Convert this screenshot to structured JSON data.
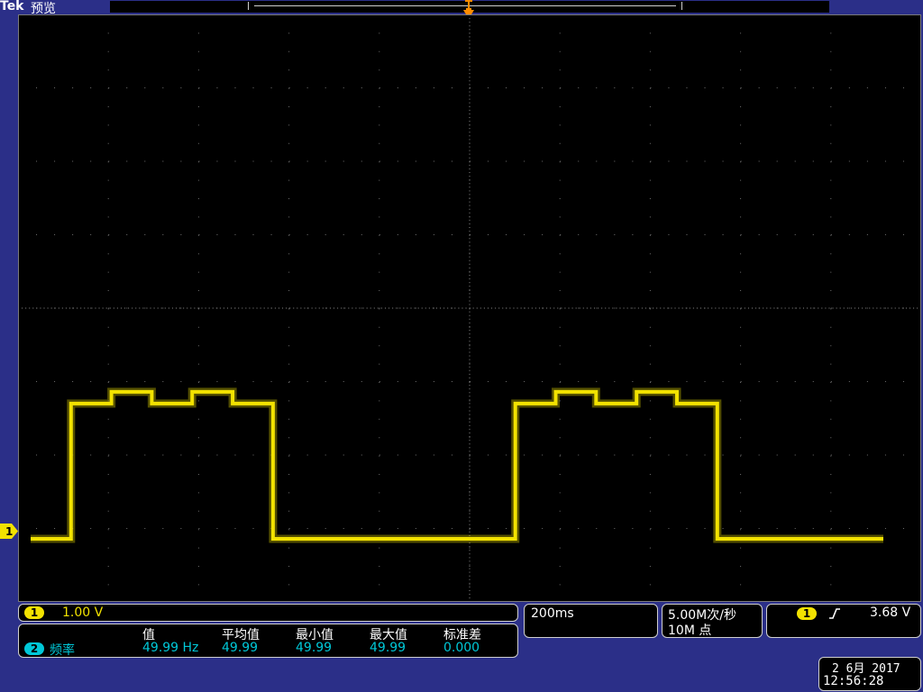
{
  "header": {
    "brand": "Tek",
    "mode": "预览"
  },
  "channel1": {
    "marker": "1",
    "scale": "1.00 V",
    "color": "#f2e200"
  },
  "measurement": {
    "badge": "2",
    "label": "频率",
    "columns": [
      "值",
      "平均值",
      "最小值",
      "最大值",
      "标准差"
    ],
    "values": [
      "49.99 Hz",
      "49.99",
      "49.99",
      "49.99",
      "0.000"
    ],
    "color": "#00c8d8"
  },
  "timebase": {
    "value": "200ms"
  },
  "acquisition": {
    "sample_rate": "5.00M次/秒",
    "record_length": "10M 点"
  },
  "trigger": {
    "source": "1",
    "slope_icon": "rising-edge-icon",
    "level": "3.68 V"
  },
  "datetime": {
    "date": "2 6月 2017",
    "time": "12:56:28"
  },
  "chart_data": {
    "type": "line",
    "series": [
      {
        "x": [
          0,
          0.18,
          0.18,
          0.36,
          0.36,
          0.54,
          0.54,
          0.72,
          0.72,
          0.9,
          0.9,
          1.08,
          1.08,
          1.26,
          1.26,
          1.44,
          1.44,
          1.62,
          1.62,
          1.8,
          1.8,
          1.98,
          1.98,
          2.16,
          2.16,
          2.34,
          2.34,
          2.52,
          2.52,
          2.7,
          2.7,
          2.88,
          2.88,
          3.06,
          3.06,
          3.24,
          3.24,
          3.42,
          3.42,
          3.6,
          3.6,
          3.8
        ],
        "y": [
          0,
          0,
          2.32,
          2.32,
          2.52,
          2.52,
          2.32,
          2.32,
          2.52,
          2.52,
          2.32,
          2.32,
          0,
          0,
          0,
          0,
          0,
          0,
          0,
          0,
          0,
          0,
          0,
          0,
          2.32,
          2.32,
          2.52,
          2.52,
          2.32,
          2.32,
          2.52,
          2.52,
          2.32,
          2.32,
          0,
          0,
          0,
          0,
          0,
          0,
          0,
          0
        ]
      }
    ],
    "xlim": [
      -1.0,
      1.0
    ],
    "ylim": [
      -5.0,
      1.0
    ],
    "grid": true
  }
}
